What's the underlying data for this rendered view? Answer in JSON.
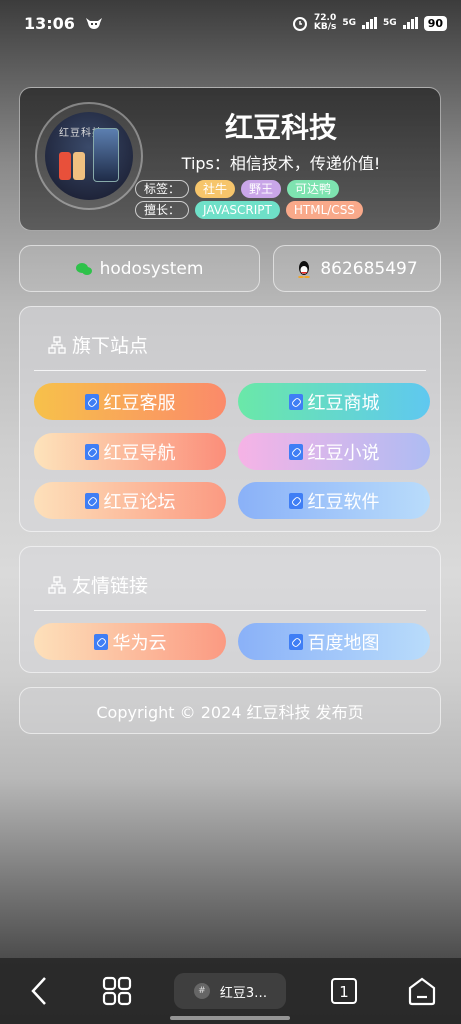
{
  "status_bar": {
    "time": "13:06",
    "speed_value": "72.0",
    "speed_unit": "KB/s",
    "net1": "5G",
    "net2": "5G",
    "battery": "90"
  },
  "profile": {
    "title": "红豆科技",
    "tips": "Tips：相信技术，传递价值!",
    "avatar_text": "红豆科技",
    "tags_label": "标签：",
    "tags": [
      {
        "text": "社牛",
        "color": "#f6c56b"
      },
      {
        "text": "野王",
        "color": "#c9a6e8"
      },
      {
        "text": "可达鸭",
        "color": "#7ee3b0"
      }
    ],
    "skills_label": "擅长：",
    "skills": [
      {
        "text": "JAVASCRIPT",
        "color": "#6fe0c8"
      },
      {
        "text": "HTML/CSS",
        "color": "#f9a98a"
      }
    ]
  },
  "contacts": {
    "wechat": "hodosystem",
    "qq": "862685497"
  },
  "sites": {
    "title": "旗下站点",
    "items": [
      {
        "label": "红豆客服",
        "gradient": "linear-gradient(90deg,#f7c14a,#fb8a6a)"
      },
      {
        "label": "红豆商城",
        "gradient": "linear-gradient(90deg,#6ae8a8,#5fc8f0)"
      },
      {
        "label": "红豆导航",
        "gradient": "linear-gradient(90deg,#fde3bb,#fb8e7a)"
      },
      {
        "label": "红豆小说",
        "gradient": "linear-gradient(90deg,#f6b3e6,#aebcf3)"
      },
      {
        "label": "红豆论坛",
        "gradient": "linear-gradient(90deg,#fde0ba,#fb9a82)"
      },
      {
        "label": "红豆软件",
        "gradient": "linear-gradient(90deg,#8ab1f8,#b9dcfb)"
      }
    ]
  },
  "friends": {
    "title": "友情链接",
    "items": [
      {
        "label": "华为云",
        "gradient": "linear-gradient(90deg,#fde0ba,#fb9a82)"
      },
      {
        "label": "百度地图",
        "gradient": "linear-gradient(90deg,#8ab1f8,#b9dcfb)"
      }
    ]
  },
  "footer": {
    "copyright": "Copyright © 2024 红豆科技 发布页"
  },
  "nav": {
    "tab_title": "红豆3…",
    "tab_count": "1",
    "tab_icon": "#"
  }
}
